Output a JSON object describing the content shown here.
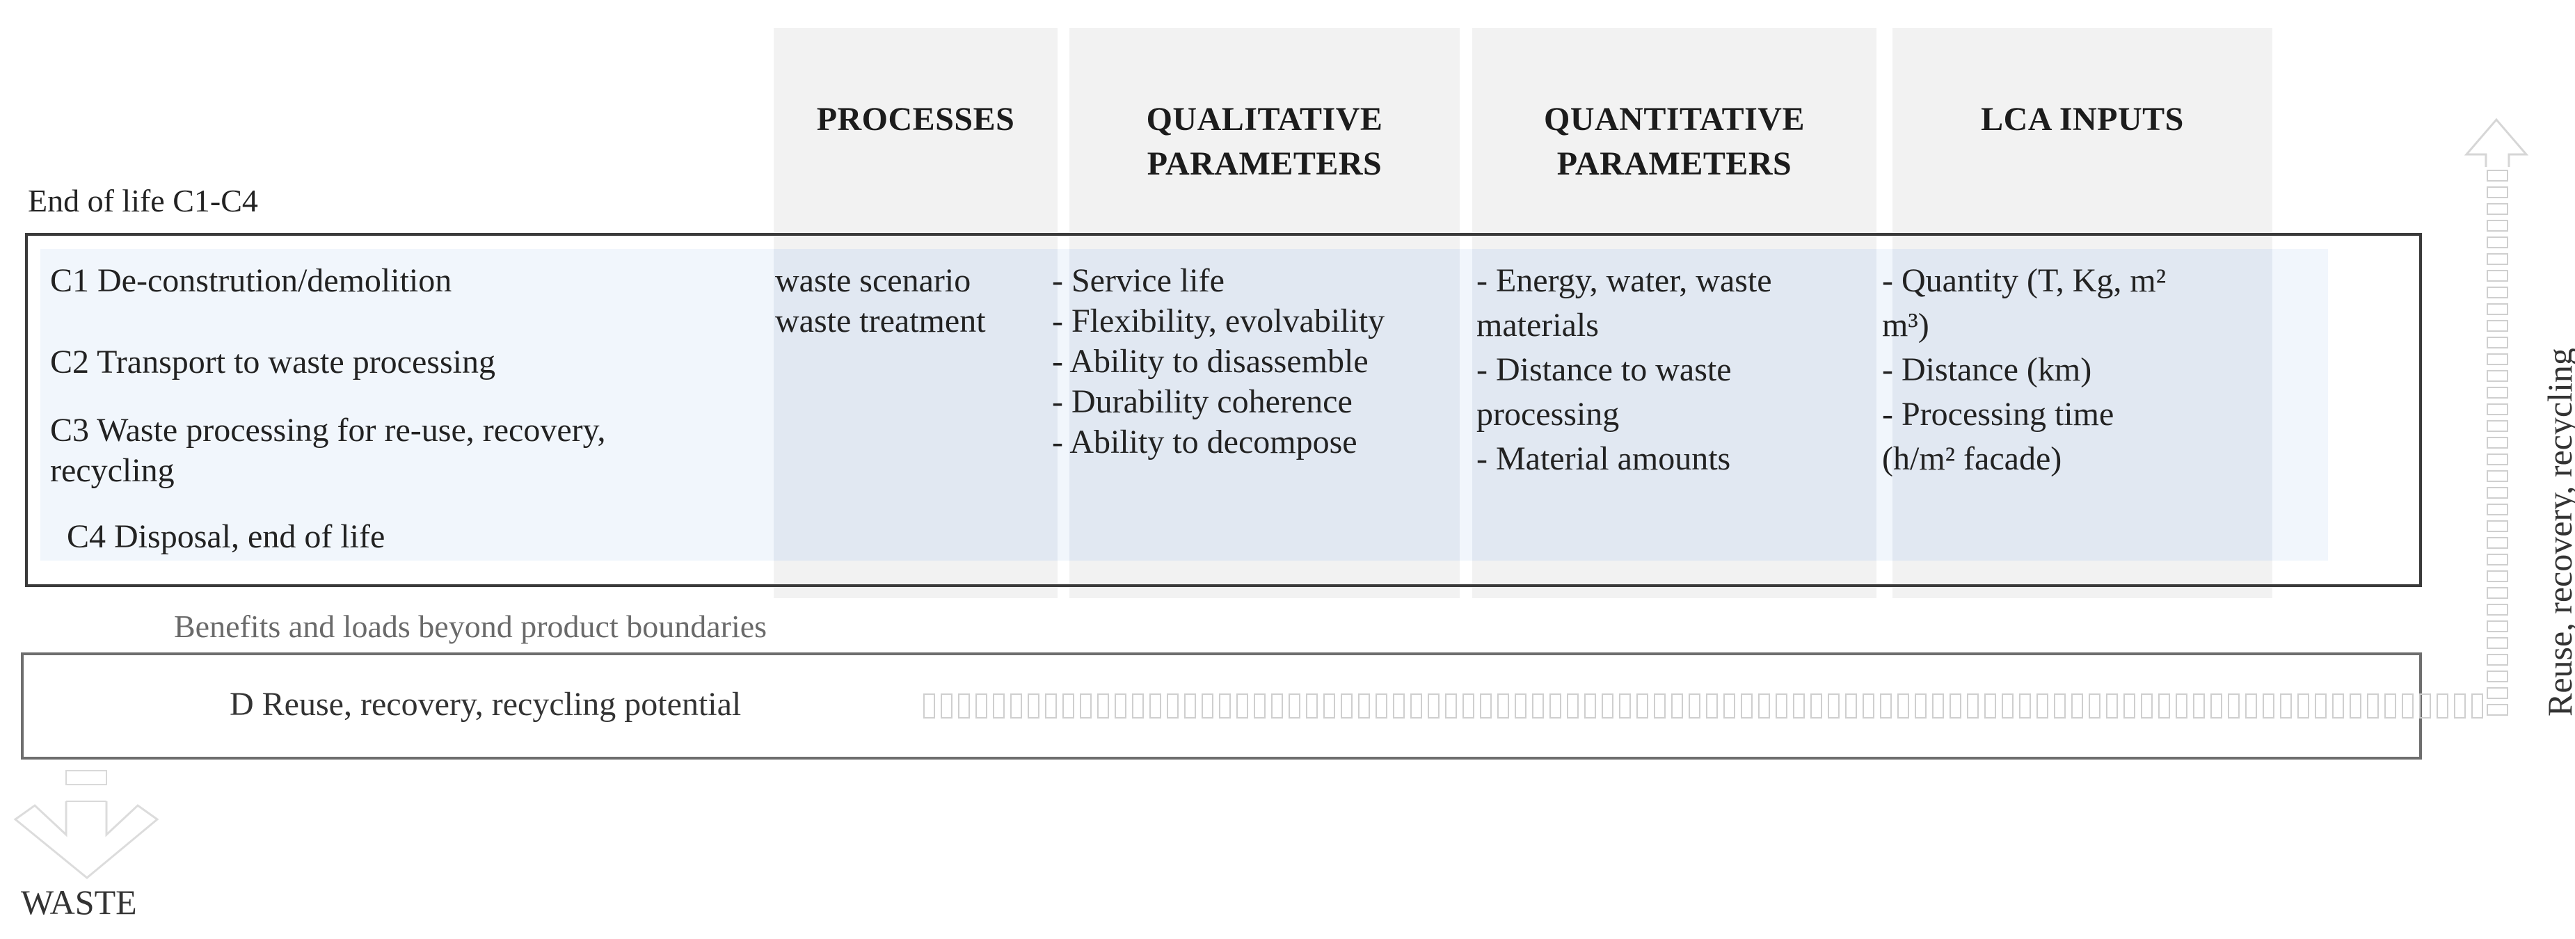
{
  "section_label": "End of life C1-C4",
  "columns": [
    {
      "id": "processes",
      "title_lines": [
        "PROCESSES"
      ]
    },
    {
      "id": "qualitative",
      "title_lines": [
        "QUALITATIVE",
        "PARAMETERS"
      ]
    },
    {
      "id": "quantitative",
      "title_lines": [
        "QUANTITATIVE",
        "PARAMETERS"
      ]
    },
    {
      "id": "lca",
      "title_lines": [
        "LCA INPUTS"
      ]
    }
  ],
  "stages": [
    {
      "code": "C1",
      "label": "C1 De-constrution/demolition"
    },
    {
      "code": "C2",
      "label": "C2 Transport to waste processing"
    },
    {
      "code": "C3",
      "label_lines": [
        "C3 Waste processing for re-use, recovery,",
        "recycling"
      ]
    },
    {
      "code": "C4",
      "label": "C4 Disposal, end of life"
    }
  ],
  "processes": [
    "waste scenario",
    "waste treatment"
  ],
  "qualitative_parameters": [
    "- Service life",
    "- Flexibility, evolvability",
    "- Ability to disassemble",
    "- Durability coherence",
    "- Ability to decompose"
  ],
  "quantitative_parameters": [
    "- Energy, water, waste",
    "materials",
    "- Distance to waste",
    "processing",
    "- Material amounts"
  ],
  "lca_inputs": [
    "- Quantity (T, Kg, m²",
    "m³)",
    "- Distance (km)",
    "- Processing time",
    "(h/m² facade)"
  ],
  "beyond_label": "Benefits and loads beyond product boundaries",
  "module_d_label": "D Reuse, recovery, recycling potential",
  "right_arrow_label": "Reuse, recovery, recycling",
  "waste_label": "WASTE",
  "colors": {
    "header_bg": "#f2f2f2",
    "band_bg": "#eaf1f8",
    "box_border": "#3a3a3a",
    "arrow_stroke": "#d9d9d9"
  }
}
